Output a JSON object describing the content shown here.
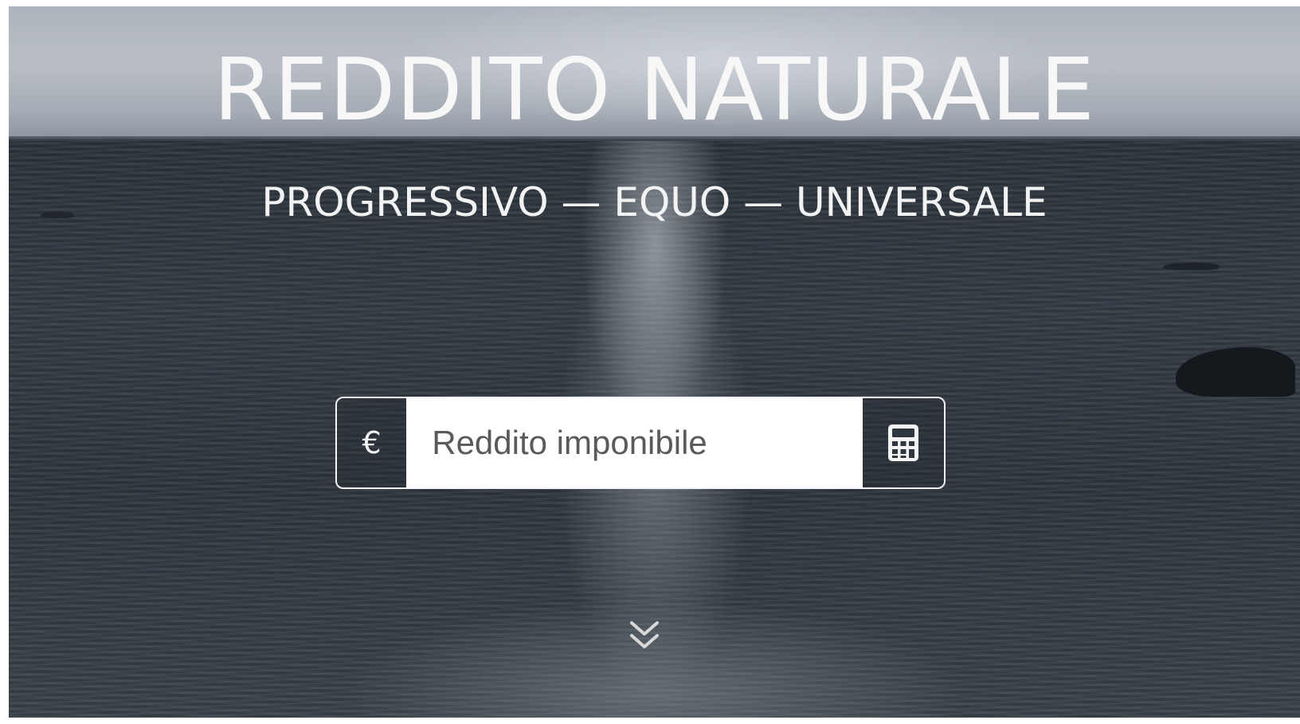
{
  "hero": {
    "title": "REDDITO NATURALE",
    "subtitle": "PROGRESSIVO — EQUO — UNIVERSALE"
  },
  "income_form": {
    "currency_symbol": "€",
    "placeholder": "Reddito imponibile",
    "value": "",
    "submit_icon": "calculator-icon"
  },
  "scroll_hint": {
    "icon": "chevron-down-icon"
  },
  "colors": {
    "text": "#f7f7f7",
    "input_bg": "#ffffff",
    "placeholder": "#5a5a5a",
    "border": "#f4f4f4"
  }
}
